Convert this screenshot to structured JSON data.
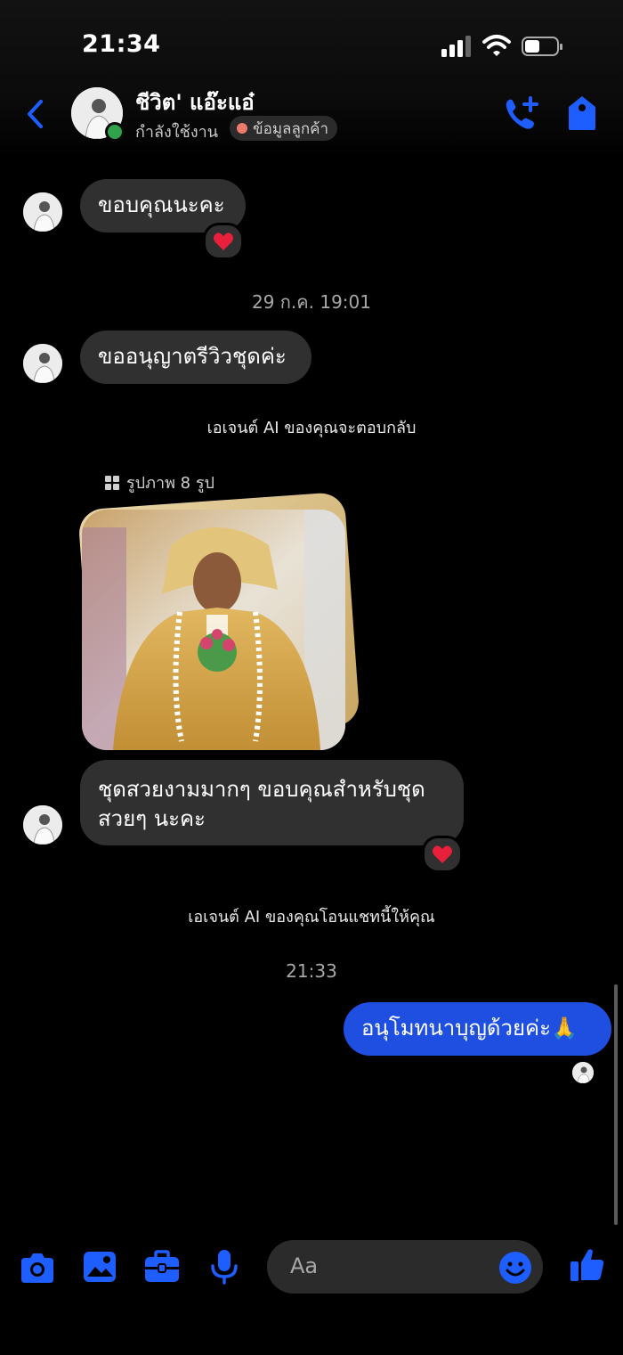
{
  "status_bar": {
    "time": "21:34"
  },
  "header": {
    "contact_name": "ชีวิต' แอ๊ะแอ๋",
    "status": "กำลังใช้งาน",
    "info_chip": "ข้อมูลลูกค้า",
    "accent_color": "#1e5eff"
  },
  "messages": {
    "m1": {
      "text": "ขอบคุณนะคะ",
      "reaction": "❤️"
    },
    "ts1": "29 ก.ค. 19:01",
    "m2": {
      "text": "ขออนุญาตรีวิวชุดค่ะ"
    },
    "sys1": "เอเจนต์ AI ของคุณจะตอบกลับ",
    "photos_label": "รูปภาพ 8 รูป",
    "m3": {
      "text_line1": "ชุดสวยงามมากๆ ขอบคุณสำหรับชุด",
      "text_line2": "สวยๆ นะคะ",
      "reaction": "❤️"
    },
    "sys2": "เอเจนต์ AI ของคุณโอนแชทนี้ให้คุณ",
    "ts2": "21:33",
    "m4": {
      "text": "อนุโมทนาบุญด้วยค่ะ🙏"
    }
  },
  "composer": {
    "placeholder": "Aa",
    "icons": [
      "camera-icon",
      "gallery-icon",
      "briefcase-icon",
      "microphone-icon",
      "emoji-icon",
      "thumbs-up-icon"
    ]
  }
}
